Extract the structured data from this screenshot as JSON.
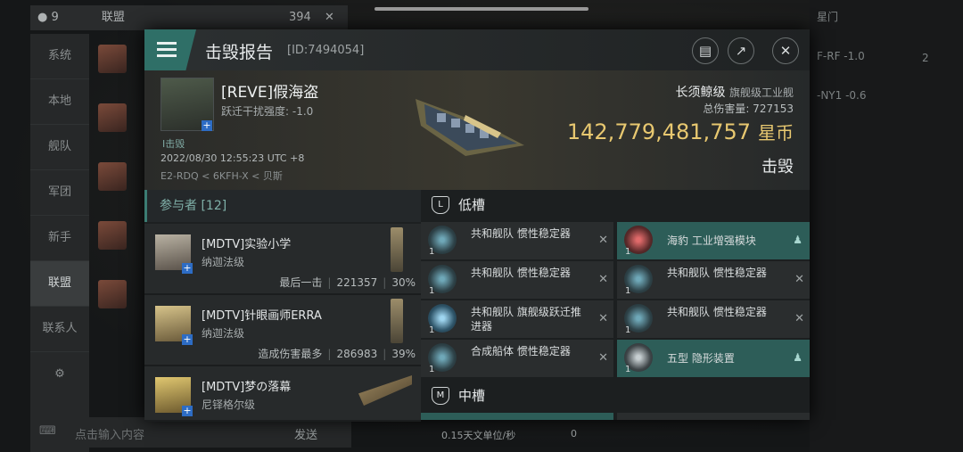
{
  "background": {
    "player_count": "9",
    "channel_title": "联盟",
    "channel_count": "394",
    "nav": [
      "系统",
      "本地",
      "舰队",
      "军团",
      "新手",
      "联盟",
      "联系人"
    ],
    "input_placeholder": "点击输入内容",
    "send_label": "发送",
    "right_tab": "星门",
    "right_items": [
      "F-RF -1.0",
      "-NY1 -0.6"
    ],
    "right_count": "2",
    "speed": "0.15天文单位/秒",
    "speed_zero": "0"
  },
  "report": {
    "title": "击毁报告",
    "id": "[ID:7494054]",
    "victim": {
      "name": "[REVE]假海盗",
      "warp_disrupt": "跃迁干扰强度: -1.0",
      "kill_label": "I击毁",
      "time": "2022/08/30 12:55:23 UTC +8",
      "location": "E2-RDQ < 6KFH-X < 贝斯"
    },
    "ship": {
      "name": "长须鲸级",
      "class": "旗舰级工业舰",
      "total_damage_label": "总伤害量: 727153",
      "value": "142,779,481,757",
      "currency": "星币",
      "result": "击毁"
    }
  },
  "participants": {
    "header": "参与者 [12]",
    "rows": [
      {
        "name": "[MDTV]实验小学",
        "ship": "纳迦法级",
        "tag": "最后一击",
        "damage": "221357",
        "pct": "30%"
      },
      {
        "name": "[MDTV]针眼画师ERRA",
        "ship": "纳迦法级",
        "tag": "造成伤害最多",
        "damage": "286983",
        "pct": "39%"
      },
      {
        "name": "[MDTV]梦の落幕",
        "ship": "尼铎格尔级",
        "tag": "",
        "damage": "",
        "pct": ""
      }
    ]
  },
  "fitting": {
    "low_slot_label": "低槽",
    "mid_slot_label": "中槽",
    "low_modules": [
      {
        "name": "共和舰队 惯性稳定器",
        "qty": "1"
      },
      {
        "name": "海豹 工业增强模块",
        "qty": "1"
      },
      {
        "name": "共和舰队 惯性稳定器",
        "qty": "1"
      },
      {
        "name": "共和舰队 惯性稳定器",
        "qty": "1"
      },
      {
        "name": "共和舰队 旗舰级跃迁推进器",
        "qty": "1"
      },
      {
        "name": "共和舰队 惯性稳定器",
        "qty": "1"
      },
      {
        "name": "合成船体 惯性稳定器",
        "qty": "1"
      },
      {
        "name": "五型 隐形装置",
        "qty": "1"
      }
    ]
  }
}
